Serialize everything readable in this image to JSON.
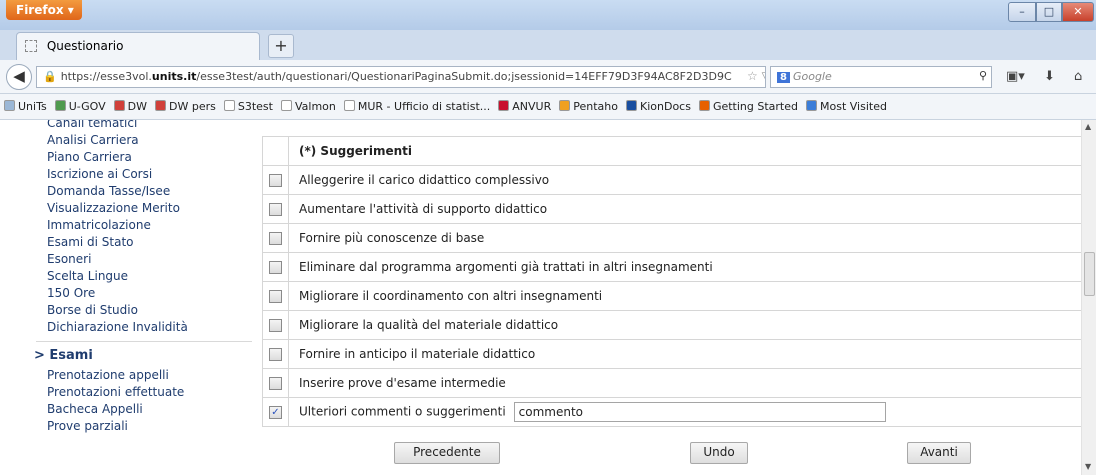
{
  "browser": {
    "menu_label": "Firefox ▾",
    "window_controls": {
      "minimize": "–",
      "maximize": "□",
      "close": "✕"
    },
    "tab": {
      "title": "Questionario",
      "new_tab": "+"
    },
    "url": {
      "prefix": "https://esse3vol.",
      "domain": "units.it",
      "rest": "/esse3test/auth/questionari/QuestionariPaginaSubmit.do;jsessionid=14EFF79D3F94AC8F2D3D9C"
    },
    "search": {
      "engine_badge": "8",
      "placeholder": "Google"
    },
    "bookmarks": [
      {
        "label": "UniTs",
        "color": "#9bb7d6"
      },
      {
        "label": "U-GOV",
        "color": "#4f9a4f"
      },
      {
        "label": "DW",
        "color": "#d0403a"
      },
      {
        "label": "DW pers",
        "color": "#d0403a"
      },
      {
        "label": "S3test",
        "color": "#ffffff"
      },
      {
        "label": "Valmon",
        "color": "#ffffff"
      },
      {
        "label": "MUR - Ufficio di statist...",
        "color": "#ffffff"
      },
      {
        "label": "ANVUR",
        "color": "#c8102e"
      },
      {
        "label": "Pentaho",
        "color": "#f0a020"
      },
      {
        "label": "KionDocs",
        "color": "#1a4fa0"
      },
      {
        "label": "Getting Started",
        "color": "#e66000"
      },
      {
        "label": "Most Visited",
        "color": "#3b7dd8"
      }
    ]
  },
  "sidebar": {
    "items_top": [
      "Canali tematici",
      "Analisi Carriera",
      "Piano Carriera",
      "Iscrizione ai Corsi",
      "Domanda Tasse/Isee",
      "Visualizzazione Merito",
      "Immatricolazione",
      "Esami di Stato",
      "Esoneri",
      "Scelta Lingue",
      "150 Ore",
      "Borse di Studio",
      "Dichiarazione Invalidità"
    ],
    "section_head": "> Esami",
    "items_bottom": [
      "Prenotazione appelli",
      "Prenotazioni effettuate",
      "Bacheca Appelli",
      "Prove parziali"
    ]
  },
  "questionnaire": {
    "header": "(*) Suggerimenti",
    "options": [
      {
        "label": "Alleggerire il carico didattico complessivo",
        "checked": false
      },
      {
        "label": "Aumentare l'attività di supporto didattico",
        "checked": false
      },
      {
        "label": "Fornire più conoscenze di base",
        "checked": false
      },
      {
        "label": "Eliminare dal programma argomenti già trattati in altri insegnamenti",
        "checked": false
      },
      {
        "label": "Migliorare il coordinamento con altri insegnamenti",
        "checked": false
      },
      {
        "label": "Migliorare la qualità del materiale didattico",
        "checked": false
      },
      {
        "label": "Fornire in anticipo il materiale didattico",
        "checked": false
      },
      {
        "label": "Inserire prove d'esame intermedie",
        "checked": false
      },
      {
        "label": "Ulteriori commenti o suggerimenti",
        "checked": true
      }
    ],
    "comment_value": "commento"
  },
  "buttons": {
    "previous": "Precedente",
    "undo": "Undo",
    "next": "Avanti"
  }
}
